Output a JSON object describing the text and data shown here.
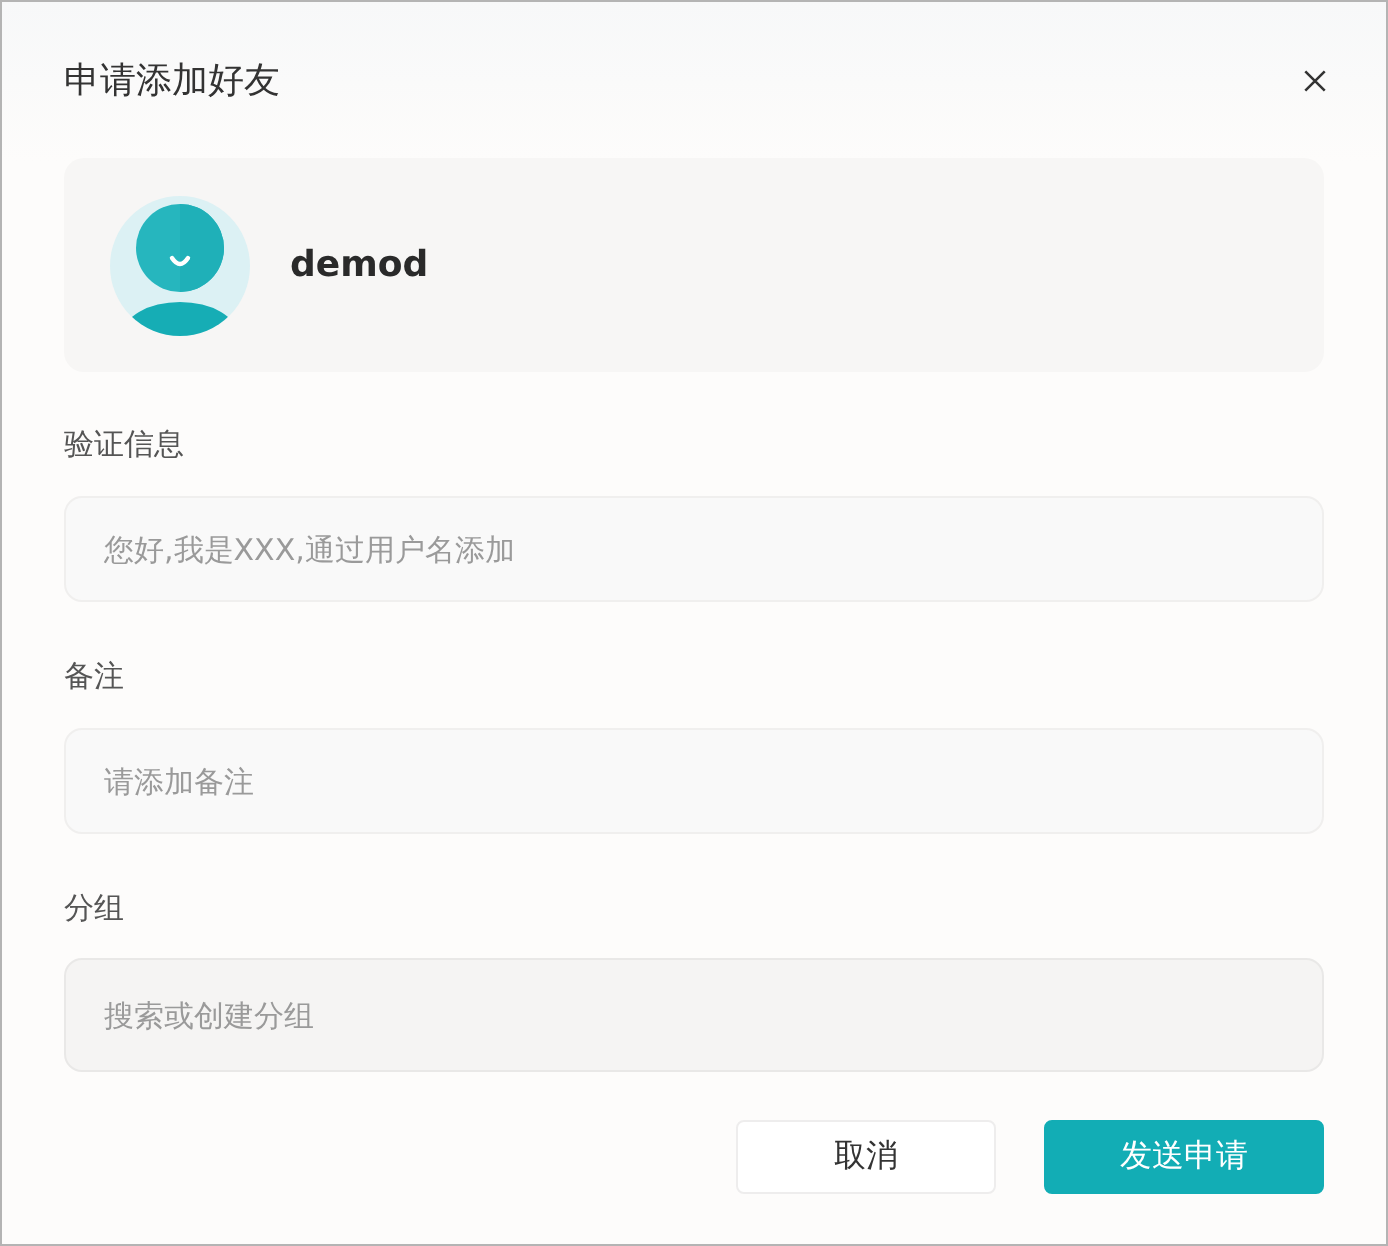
{
  "dialog": {
    "title": "申请添加好友"
  },
  "user": {
    "name": "demod"
  },
  "fields": [
    {
      "label": "验证信息",
      "placeholder": "您好,我是XXX,通过用户名添加",
      "kind": "input"
    },
    {
      "label": "备注",
      "placeholder": "请添加备注",
      "kind": "input"
    },
    {
      "label": "分组",
      "placeholder": "搜索或创建分组",
      "kind": "select"
    }
  ],
  "buttons": [
    {
      "label": "取消",
      "kind": "secondary"
    },
    {
      "label": "发送申请",
      "kind": "primary"
    }
  ]
}
